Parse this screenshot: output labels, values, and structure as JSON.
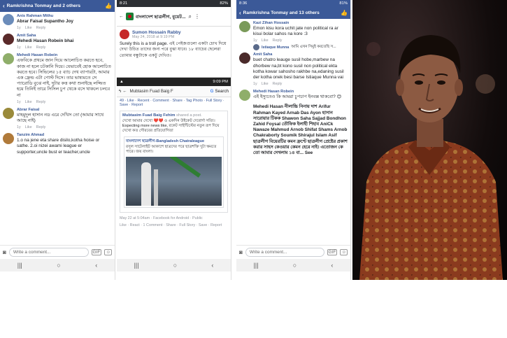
{
  "panel1": {
    "header_title": "Ramkrishna Tonmay and 2 others",
    "comments": [
      {
        "name": "Anis Rahman Mithu",
        "text": "Abrar Faisal Supantho Joy",
        "bold": true,
        "meta": [
          "1y",
          "Like",
          "Reply"
        ]
      },
      {
        "name": "Amit Saha",
        "text": "Mehedi Hasan Robein bhai",
        "bold": true,
        "meta": [
          "1y",
          "Like",
          "Reply"
        ]
      },
      {
        "name": "Mehedi Hasan Robein",
        "text": "এফবিকে প্রথমে জান দিয়ে আলোচিত করতে হবে, কাজ না হলে চটকানি দিয়ে। যেভাবেই হোক আলোচিত করতে হবে। সিভিলের ১৫ ব্যাচ দেখ ব্যাপারটা, আমার এক ফ্রেন্ড এটা পোস্ট দিসে। তার ভাষ্যমতে সে প্যারোডি বুঝে নাই, দুটার কত্ত কথা শুনাইছে লজ্জিত হয়ে তিনিই তারে সিসিল চুপ থেকে বসে থাকলে চলবে না",
        "bold": false,
        "meta": [
          "1y",
          "Like",
          "Reply"
        ]
      },
      {
        "name": "Abrar Faisal",
        "text": "মাহমুদুল হাসান নড এরে দেখিস তো (আমার সাথে আছে নাই)",
        "bold": false,
        "meta": [
          "1y",
          "Like",
          "Reply"
        ]
      },
      {
        "name": "Tanzim Ahmad",
        "text": "1.o na jene eta share disilo,kotha hoise or sathe. 2.oi nizei awami league er supporter,uncle bust er teacher,uncle",
        "bold": false,
        "meta": []
      }
    ],
    "write_placeholder": "Write a comment..."
  },
  "panel2": {
    "status_time": "8:21",
    "status_right": "82%",
    "page_title": "বাংলাদেশ ছাত্রলীগ, বুয়েট...",
    "poster": "Sumon Hossain Rabby",
    "post_date": "May 24, 2018 at 9:19 PM",
    "post_text": "Surely this is a troll page. এই পেইজগুলো একটা চোখ দিয়ে দেখা উচিত তাদের জন্য পরে বুঝা যাবে। ১৮ ব্যাচের ছেলেরা তোমার বন্ধুটাকে একটু দেখিও।",
    "shot_time": "9:09 PM",
    "shot_title": "Mubtasim Fuad Baig F",
    "search_label": "Search",
    "shot_meta": "49 · Like · Recent · Comment · Share · Tag Photo · Full Story · Save · Report",
    "share_name": "Mubtasim Fuad Baig Fehim",
    "share_action": "shared a post.",
    "share_text": "দেখো আমার দেখো ❤️❤️ ও একদিন উইকেট দেবোর্দা সত্যি। Expecting more news like, রকেট সাইন্টিস্টের নতুন রূপ দিয়ে দেখো কত গৌরবের প্রতিযোগিতা",
    "inner_name": "বাংলাদেশ ছাত্রলীগ-Bangladesh Chatraleague",
    "inner_text": "রসুল সাটেলাইট আকাশে ছাত্রদের পরে ছাত্রশক্তি দুটা ক্ষমতে পারে। জয় বাংলা।",
    "shot_footer": "May 22 at 5:04am · Facebook for Android · Public",
    "shot_footer2": "Like · React · 1 Comment · Share · Full Story · Save · Report"
  },
  "panel3": {
    "status_time": "8:36",
    "status_right": "81%",
    "header_title": "Ramkrishna Tonmay and 13 others",
    "comments": [
      {
        "name": "Kazi Zihan Hossain",
        "text": "Emon kisu kora uchit jate non political ra ar kisui bolar sahos na kore :3",
        "bold": false,
        "meta": [
          "1y",
          "Like",
          "Reply"
        ]
      },
      {
        "name": "Amit Saha",
        "text": "buet chatro leauge susil hobe,marbew na dhorbew na,bt kono susil non political ekta kotha kowar sahosho rakhbe na,edaning susil der kotha onek besi barse Istiaque Munna vai",
        "bold": false,
        "meta": [
          "1y",
          "Like",
          "Reply"
        ]
      },
      {
        "name": "Mehedi Hasan Robein",
        "text": "এই ইস্যুতেও কি আমরা চুপচাপ ইনবক্স থাকবো? 😊",
        "bold": false,
        "meta": []
      }
    ],
    "reply": {
      "name": "Istiaque Munna",
      "text": "আমি এখন সিমুই করতেছি স..."
    },
    "mentions": "Mehedi Hasan নীলাচ্চি নিনায় দাশ Arifur Rahman Kayed Arnab Das Ayon হাসান সারোয়ার টিকক Shawon Saha Sajjad Bondhon Zahid Foysal তৌফিক ইলাহী শিহাব AniCk Nawaze Mahmud Arnob Shifat Shams Arnob Chakraborty Soumik Shirajul Islam Asif ছাত্রলীগ বিয়েরটির কমন ফ্রণ্টে ছাত্রলীগ প্রেষ্টের প্রকাশ করার সাহস কেওয়ার কেমন হেরে নাই। এতোজন কে তো আমার দেখলাম ১৪ বা... See",
    "write_placeholder": "Write a comment..."
  },
  "colors": {
    "fb_blue": "#3b5998",
    "link": "#385898",
    "meta": "#90949c"
  }
}
